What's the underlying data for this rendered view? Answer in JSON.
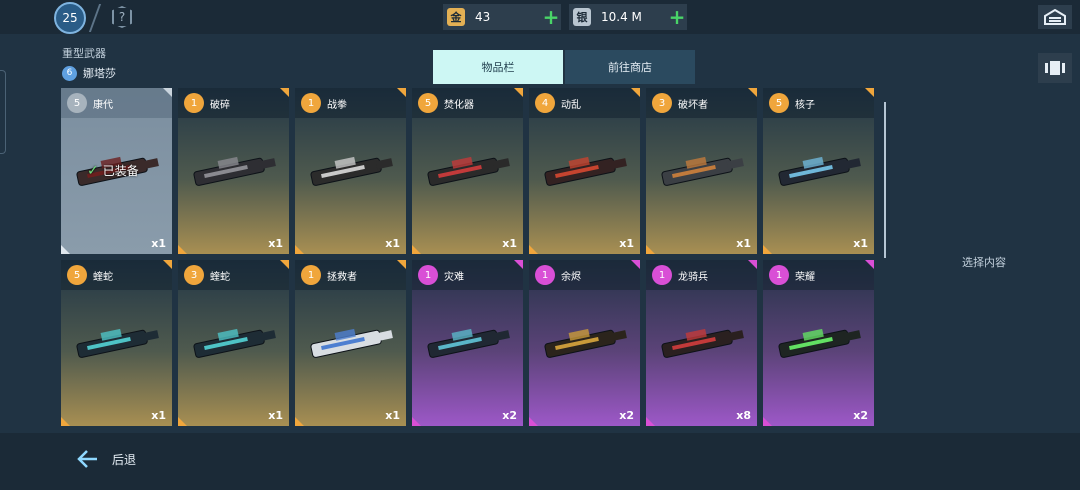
{
  "header": {
    "player_level": "25",
    "help_symbol": "?",
    "gold": {
      "icon_char": "金",
      "value": "43",
      "plus": "+"
    },
    "silver": {
      "icon_char": "银",
      "value": "10.4 M",
      "plus": "+"
    },
    "category": "重型武器",
    "pilot_level": "6",
    "pilot_name": "娜塔莎"
  },
  "tabs": [
    {
      "label": "物品栏",
      "active": true
    },
    {
      "label": "前往商店",
      "active": false
    }
  ],
  "equipped_label": "已装备",
  "items": [
    {
      "level": "5",
      "name": "康代",
      "qty": "x1",
      "rarity": "grey",
      "equipped": true
    },
    {
      "level": "1",
      "name": "破碎",
      "qty": "x1",
      "rarity": "orange"
    },
    {
      "level": "1",
      "name": "战拳",
      "qty": "x1",
      "rarity": "orange"
    },
    {
      "level": "5",
      "name": "焚化器",
      "qty": "x1",
      "rarity": "orange"
    },
    {
      "level": "4",
      "name": "动乱",
      "qty": "x1",
      "rarity": "orange"
    },
    {
      "level": "3",
      "name": "破坏者",
      "qty": "x1",
      "rarity": "orange"
    },
    {
      "level": "5",
      "name": "核子",
      "qty": "x1",
      "rarity": "orange"
    },
    {
      "level": "5",
      "name": "蝰蛇",
      "qty": "x1",
      "rarity": "orange"
    },
    {
      "level": "3",
      "name": "蝰蛇",
      "qty": "x1",
      "rarity": "orange"
    },
    {
      "level": "1",
      "name": "拯救者",
      "qty": "x1",
      "rarity": "orange"
    },
    {
      "level": "1",
      "name": "灾难",
      "qty": "x2",
      "rarity": "purple"
    },
    {
      "level": "1",
      "name": "余烬",
      "qty": "x2",
      "rarity": "purple"
    },
    {
      "level": "1",
      "name": "龙骑兵",
      "qty": "x8",
      "rarity": "purple"
    },
    {
      "level": "1",
      "name": "荣耀",
      "qty": "x2",
      "rarity": "purple"
    }
  ],
  "detail_panel": {
    "hint": "选择内容"
  },
  "footer": {
    "back_label": "后退"
  },
  "colors": {
    "accent_orange": "#f0a63c",
    "accent_purple": "#d94fd6",
    "tab_active": "#cdf7f4",
    "plus_green": "#49d468"
  }
}
